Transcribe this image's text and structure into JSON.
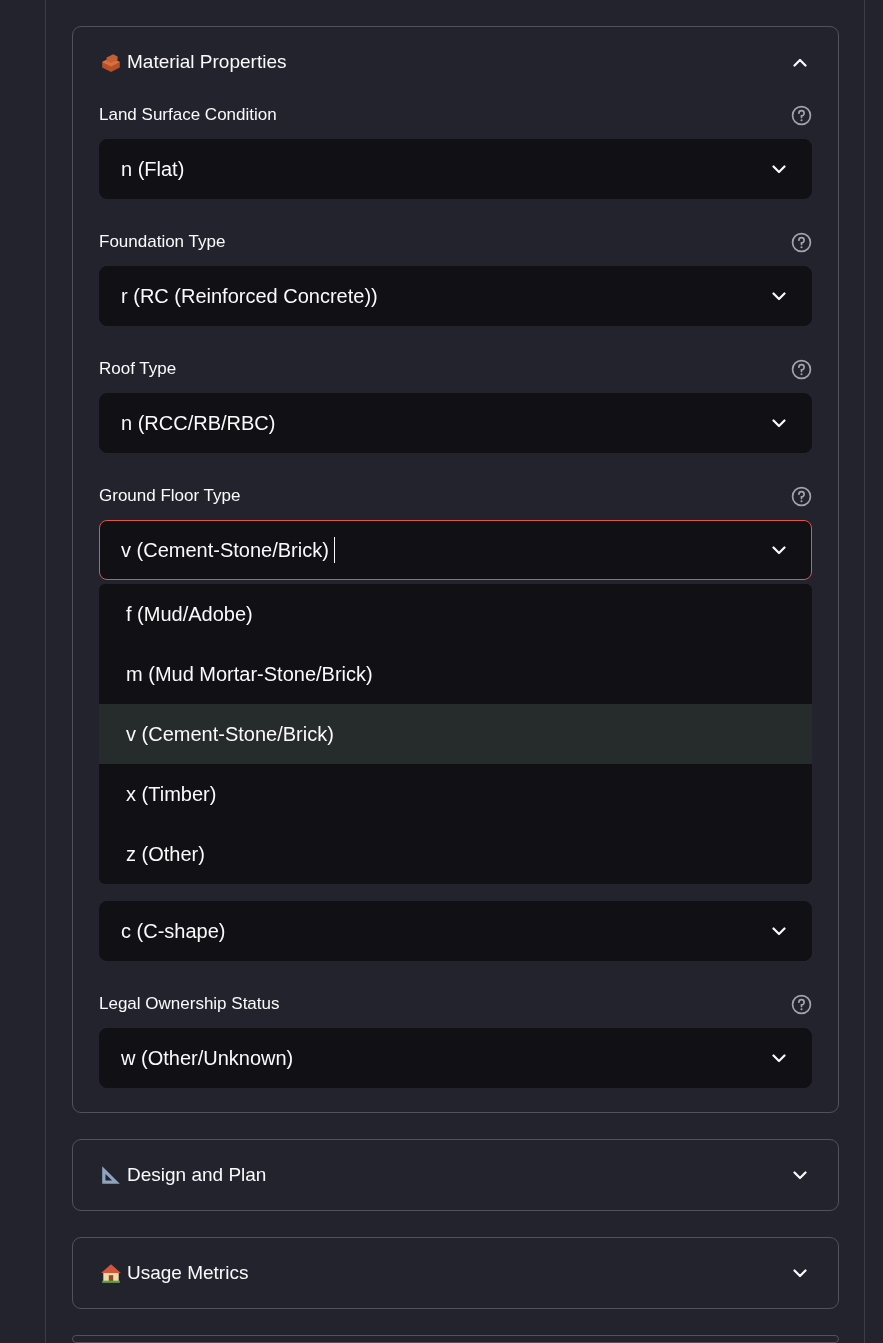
{
  "sections": [
    {
      "title": "Material Properties",
      "expanded": true,
      "fields": [
        {
          "label": "Land Surface Condition",
          "value": "n (Flat)",
          "focused": false
        },
        {
          "label": "Foundation Type",
          "value": "r (RC (Reinforced Concrete))",
          "focused": false
        },
        {
          "label": "Roof Type",
          "value": "n (RCC/RB/RBC)",
          "focused": false
        },
        {
          "label": "Ground Floor Type",
          "value": "v (Cement-Stone/Brick)",
          "focused": true,
          "options": [
            {
              "label": "f (Mud/Adobe)",
              "selected": false
            },
            {
              "label": "m (Mud Mortar-Stone/Brick)",
              "selected": false
            },
            {
              "label": "v (Cement-Stone/Brick)",
              "selected": true
            },
            {
              "label": "x (Timber)",
              "selected": false
            },
            {
              "label": "z (Other)",
              "selected": false
            }
          ]
        },
        {
          "value": "c (C-shape)",
          "focused": false
        },
        {
          "label": "Legal Ownership Status",
          "value": "w (Other/Unknown)",
          "focused": false
        }
      ]
    },
    {
      "title": "Design and Plan",
      "expanded": false
    },
    {
      "title": "Usage Metrics",
      "expanded": false
    }
  ]
}
